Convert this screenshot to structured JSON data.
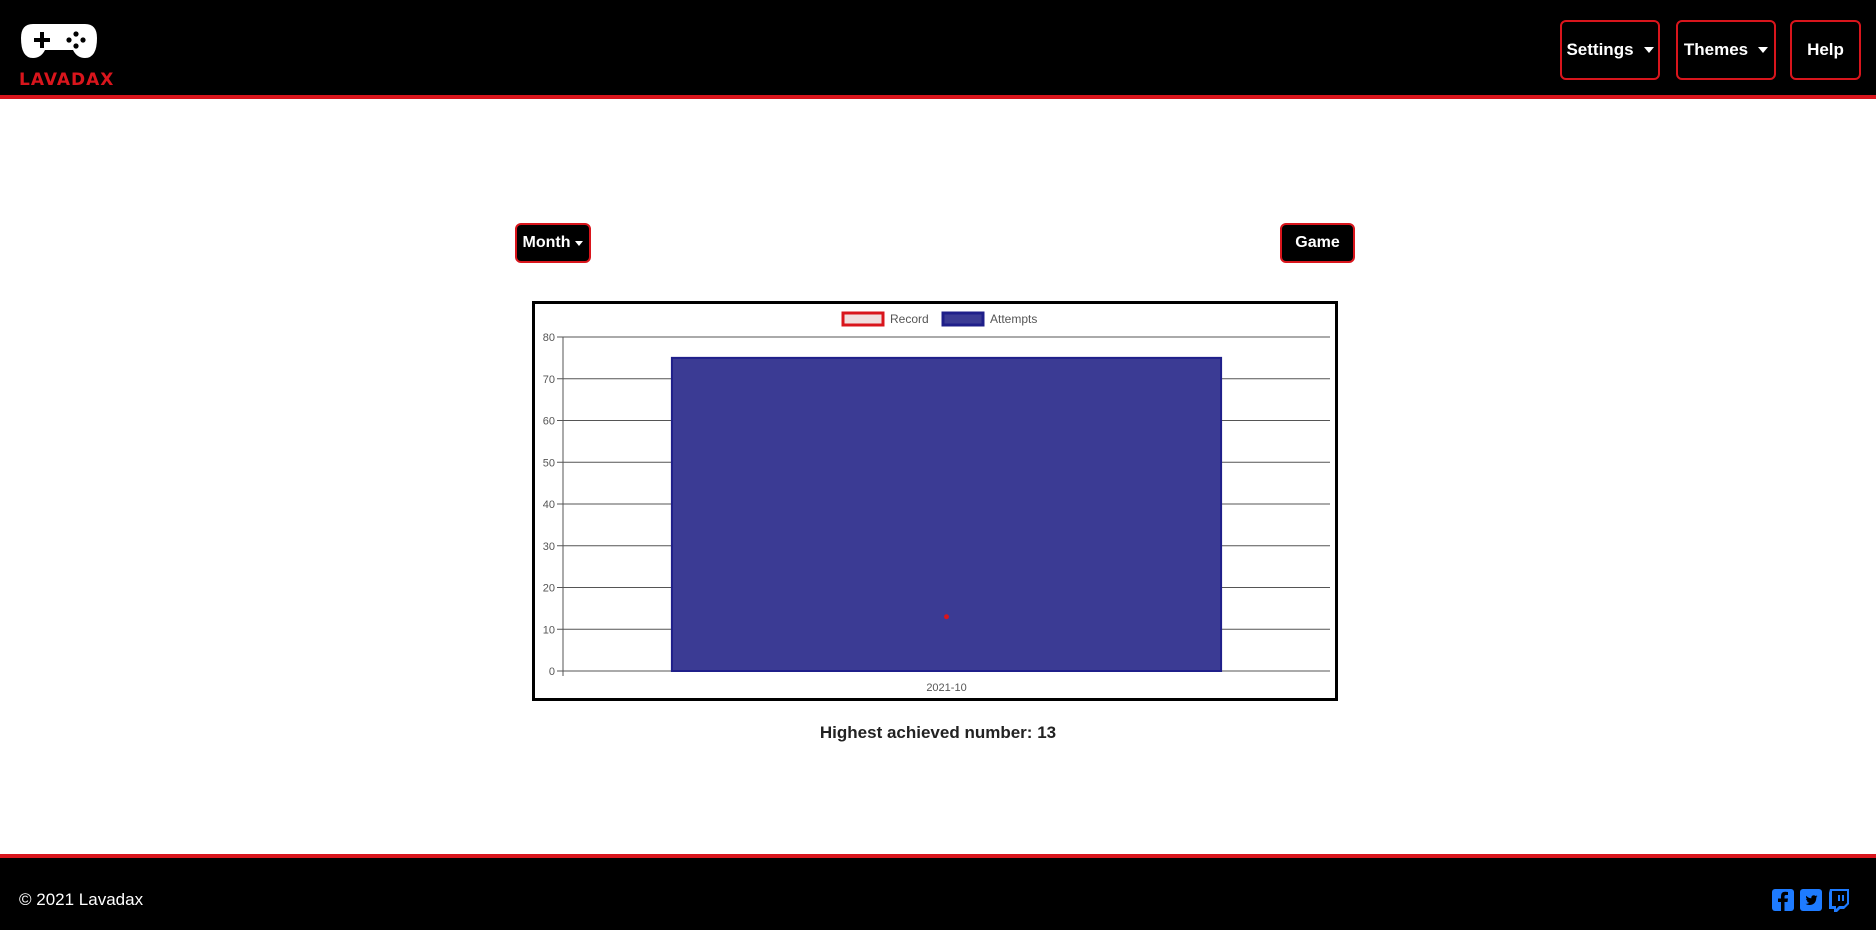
{
  "header": {
    "logo_text": "LAVADAX",
    "logo_icon": "gamepad-icon",
    "nav": [
      {
        "label": "Settings",
        "dropdown": true
      },
      {
        "label": "Themes",
        "dropdown": true
      },
      {
        "label": "Help",
        "dropdown": false
      }
    ]
  },
  "controls": {
    "period_label": "Month",
    "game_label": "Game"
  },
  "chart_data": {
    "type": "bar",
    "categories": [
      "2021-10"
    ],
    "series": [
      {
        "name": "Record",
        "values": [
          13
        ],
        "color": "#d9151c",
        "fill": "#f0dede",
        "render": "point"
      },
      {
        "name": "Attempts",
        "values": [
          75
        ],
        "color": "#1f1f8a",
        "fill": "#3b3b94",
        "render": "bar"
      }
    ],
    "ylim": [
      0,
      80
    ],
    "yticks": [
      0,
      10,
      20,
      30,
      40,
      50,
      60,
      70,
      80
    ],
    "grid": true,
    "legend": "top-center"
  },
  "summary": {
    "label": "Highest achieved number:",
    "value": "13"
  },
  "footer": {
    "copyright": "© 2021 Lavadax",
    "social": [
      "facebook-icon",
      "twitter-icon",
      "twitch-icon"
    ],
    "social_color": "#1e7bff"
  },
  "colors": {
    "accent": "#d9151c",
    "bar_fill": "#3b3b94",
    "bar_border": "#1f1f8a"
  }
}
